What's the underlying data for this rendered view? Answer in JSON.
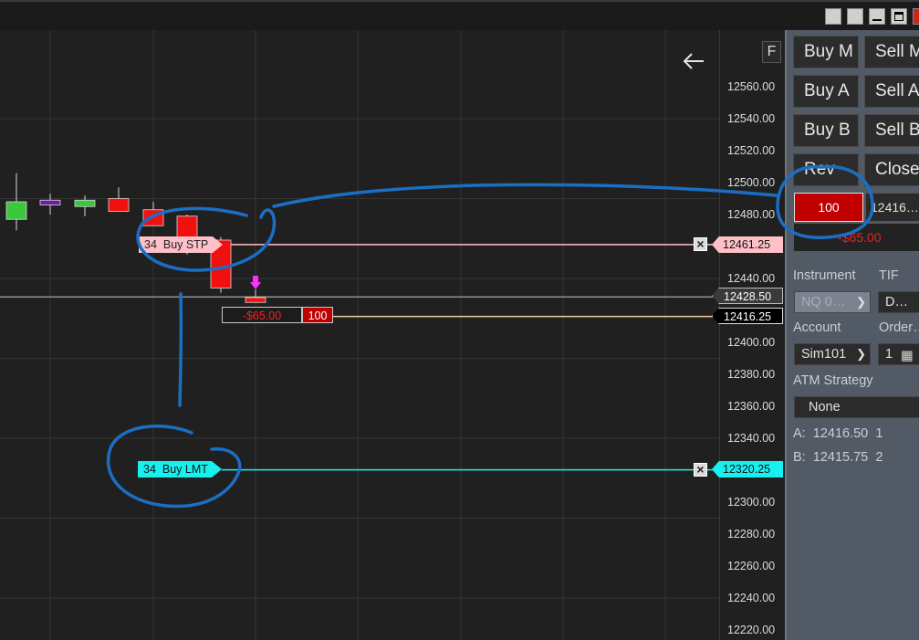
{
  "window": {
    "buttons": [
      "restore-icon",
      "minimize-icon",
      "maximize-icon",
      "close-icon"
    ]
  },
  "chart": {
    "f_button": "F",
    "back_icon": "arrow-left-icon",
    "price_axis": [
      "12560.00",
      "12540.00",
      "12520.00",
      "12500.00",
      "12480.00",
      "12440.00",
      "12400.00",
      "12380.00",
      "12360.00",
      "12340.00",
      "12300.00",
      "12280.00",
      "12260.00",
      "12240.00",
      "12220.00"
    ],
    "last_price": "12428.50",
    "buy_stp": {
      "qty": "34",
      "label": "Buy STP",
      "price": "12461.25"
    },
    "buy_lmt": {
      "qty": "34",
      "label": "Buy LMT",
      "price": "12320.25"
    },
    "position": {
      "pnl": "-$65.00",
      "qty": "100",
      "price": "12416.25"
    },
    "colors": {
      "up": "#3cc83c",
      "down": "#f01010",
      "neutral": "#6b1fa0",
      "stop": "#ffc0c8",
      "limit": "#17f0f0",
      "annotation": "#1a6fc4"
    }
  },
  "chart_data": {
    "type": "candlestick",
    "ylim": [
      12210,
      12575
    ],
    "candles": [
      {
        "open": 12477,
        "high": 12506,
        "low": 12470,
        "close": 12488,
        "color": "up"
      },
      {
        "open": 12489,
        "high": 12493,
        "low": 12480,
        "close": 12486,
        "color": "neutral"
      },
      {
        "open": 12485,
        "high": 12492,
        "low": 12479,
        "close": 12489,
        "color": "up"
      },
      {
        "open": 12490,
        "high": 12497,
        "low": 12484,
        "close": 12482,
        "color": "down"
      },
      {
        "open": 12483,
        "high": 12488,
        "low": 12475,
        "close": 12473,
        "color": "down"
      },
      {
        "open": 12479,
        "high": 12480,
        "low": 12455,
        "close": 12466,
        "color": "down"
      },
      {
        "open": 12464,
        "high": 12466,
        "low": 12431,
        "close": 12434,
        "color": "down"
      },
      {
        "open": 12428,
        "high": 12433,
        "low": 12425,
        "close": 12425,
        "color": "down"
      }
    ]
  },
  "panel": {
    "buttons": [
      {
        "buy": "Buy M",
        "sell": "Sell M"
      },
      {
        "buy": "Buy A",
        "sell": "Sell A"
      },
      {
        "buy": "Buy B",
        "sell": "Sell B"
      },
      {
        "buy": "Rev",
        "sell": "Close"
      }
    ],
    "position_qty": "100",
    "position_price": "12416…",
    "position_pnl": "-$65.00",
    "instrument_label": "Instrument",
    "tif_label": "TIF",
    "instrument_value": "NQ 0…",
    "tif_value": "D…",
    "account_label": "Account",
    "order_label": "Order…",
    "account_value": "Sim101",
    "order_value": "1",
    "atm_label": "ATM Strategy",
    "atm_value": "None",
    "ask_label": "A:",
    "ask_price": "12416.50",
    "ask_size": "1",
    "bid_label": "B:",
    "bid_price": "12415.75",
    "bid_size": "2"
  }
}
